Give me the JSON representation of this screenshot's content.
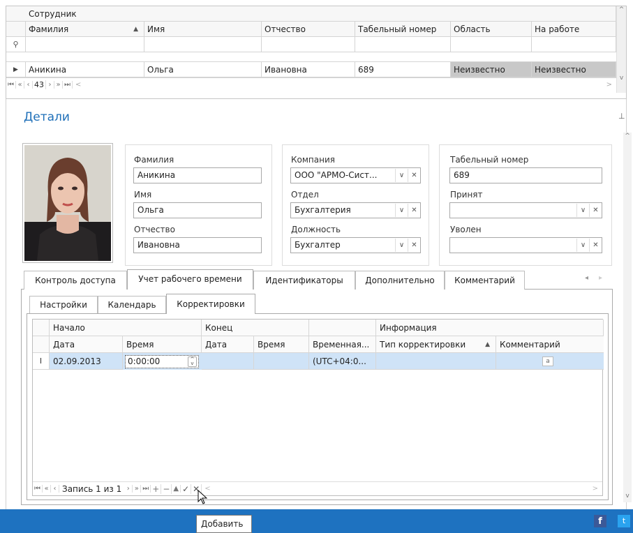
{
  "top_grid": {
    "group_header": "Сотрудник",
    "columns": [
      "Фамилия",
      "Имя",
      "Отчество",
      "Табельный номер",
      "Область",
      "На работе"
    ],
    "row": [
      "Аникина",
      "Ольга",
      "Ивановна",
      "689",
      "Неизвестно",
      "Неизвестно"
    ],
    "nav": {
      "first": "⏮",
      "prev_page": "«",
      "prev": "‹",
      "current": "43",
      "next": "›",
      "next_page": "»",
      "last": "⏭"
    }
  },
  "details": {
    "title": "Детали",
    "pin_icon": "pin-icon",
    "person": {
      "last_name_label": "Фамилия",
      "last_name": "Аникина",
      "first_name_label": "Имя",
      "first_name": "Ольга",
      "patronymic_label": "Отчество",
      "patronymic": "Ивановна"
    },
    "org": {
      "company_label": "Компания",
      "company": "ООО \"АРМО-Сист...",
      "department_label": "Отдел",
      "department": "Бухгалтерия",
      "position_label": "Должность",
      "position": "Бухгалтер"
    },
    "hr": {
      "tab_number_label": "Табельный номер",
      "tab_number": "689",
      "hired_label": "Принят",
      "hired": "",
      "fired_label": "Уволен",
      "fired": ""
    }
  },
  "tabs": [
    "Контроль доступа",
    "Учет рабочего времени",
    "Идентификаторы",
    "Дополнительно",
    "Комментарий"
  ],
  "subtabs": [
    "Настройки",
    "Календарь",
    "Корректировки"
  ],
  "corrections_grid": {
    "bands": [
      "Начало",
      "Конец",
      "",
      "Информация"
    ],
    "columns": [
      "Дата",
      "Время",
      "Дата",
      "Время",
      "Временная...",
      "Тип корректировки",
      "Комментарий"
    ],
    "row": {
      "start_date": "02.09.2013",
      "start_time": "0:00:00",
      "end_date": "",
      "end_time": "",
      "timezone": "(UTC+04:0...",
      "type": "",
      "comment_icon": "a"
    },
    "nav_text": "Запись 1 из 1"
  },
  "tooltip": "Добавить",
  "colors": {
    "accent": "#1e72c0",
    "title": "#1e6fb8",
    "selected_row": "#cfe3f7",
    "highlight_cell": "#c8c8c8"
  }
}
